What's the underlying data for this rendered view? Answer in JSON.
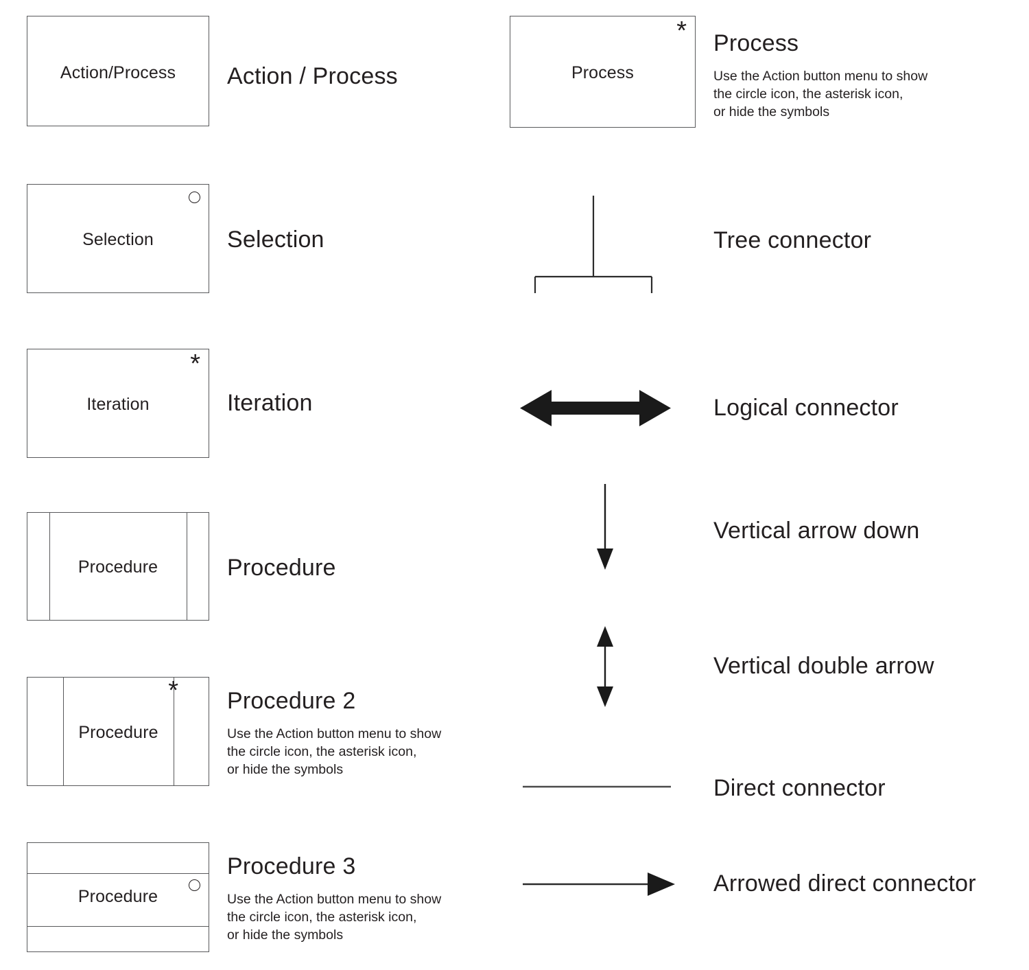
{
  "page": {
    "title": "Flowchart shapes and connectors legend",
    "background": "#ffffff",
    "stroke_color": "#58595b",
    "text_color": "#231f20",
    "connector_color": "#4a4a4a",
    "arrow_fill": "#1a1a1a"
  },
  "shapes": [
    {
      "id": "action-process",
      "inner_label": "Action/Process",
      "caption": "Action / Process",
      "description": "",
      "badge": "none"
    },
    {
      "id": "selection",
      "inner_label": "Selection",
      "caption": "Selection",
      "description": "",
      "badge": "circle-icon"
    },
    {
      "id": "iteration",
      "inner_label": "Iteration",
      "caption": "Iteration",
      "description": "",
      "badge": "asterisk-icon"
    },
    {
      "id": "procedure",
      "inner_label": "Procedure",
      "caption": "Procedure",
      "description": "",
      "badge": "none"
    },
    {
      "id": "procedure-2",
      "inner_label": "Procedure",
      "caption": "Procedure 2",
      "description": "Use the Action button menu to show\nthe circle icon, the asterisk icon,\nor hide the symbols",
      "badge": "asterisk-icon"
    },
    {
      "id": "procedure-3",
      "inner_label": "Procedure",
      "caption": "Procedure 3",
      "description": "Use the Action button menu to show\nthe circle icon, the asterisk icon,\nor hide the symbols",
      "badge": "circle-icon"
    }
  ],
  "process_shape": {
    "id": "process",
    "inner_label": "Process",
    "caption": "Process",
    "description": "Use the Action button menu to show\nthe circle icon, the asterisk icon,\nor hide the symbols",
    "badge": "asterisk-icon"
  },
  "connectors": [
    {
      "id": "tree-connector",
      "caption": "Tree connector",
      "glyph": "tree-connector-icon"
    },
    {
      "id": "logical-connector",
      "caption": "Logical connector",
      "glyph": "double-headed-horizontal-arrow-icon"
    },
    {
      "id": "vertical-arrow-down",
      "caption": "Vertical arrow down",
      "glyph": "arrow-down-icon"
    },
    {
      "id": "vertical-double-arrow",
      "caption": "Vertical double arrow",
      "glyph": "double-headed-vertical-arrow-icon"
    },
    {
      "id": "direct-connector",
      "caption": "Direct connector",
      "glyph": "horizontal-line-icon"
    },
    {
      "id": "arrowed-direct-connector",
      "caption": "Arrowed direct connector",
      "glyph": "arrow-right-icon"
    }
  ]
}
